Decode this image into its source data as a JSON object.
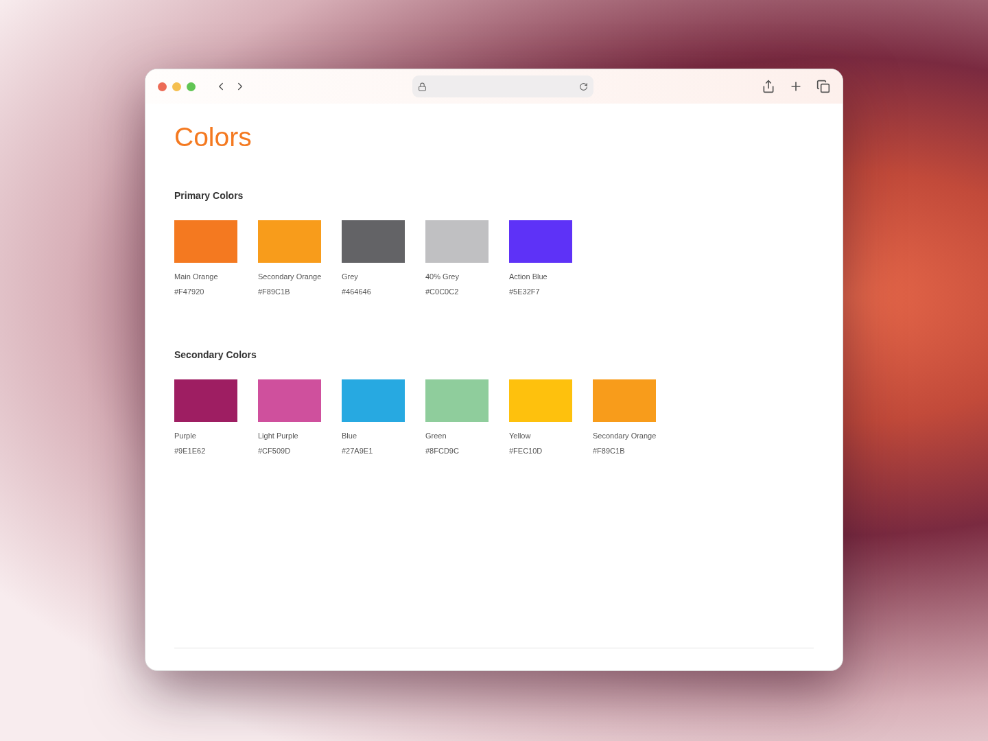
{
  "page": {
    "title": "Colors"
  },
  "sections": [
    {
      "heading": "Primary Colors",
      "swatches": [
        {
          "name": "Main Orange",
          "hex": "#F47920",
          "color": "#f47920"
        },
        {
          "name": "Secondary Orange",
          "hex": "#F89C1B",
          "color": "#f89c1b"
        },
        {
          "name": "Grey",
          "hex": "#464646",
          "color": "#636366"
        },
        {
          "name": "40% Grey",
          "hex": "#C0C0C2",
          "color": "#c0c0c2"
        },
        {
          "name": "Action Blue",
          "hex": "#5E32F7",
          "color": "#5e32f7"
        }
      ]
    },
    {
      "heading": "Secondary Colors",
      "swatches": [
        {
          "name": "Purple",
          "hex": "#9E1E62",
          "color": "#9e1e62"
        },
        {
          "name": "Light Purple",
          "hex": "#CF509D",
          "color": "#cf509d"
        },
        {
          "name": "Blue",
          "hex": "#27A9E1",
          "color": "#27a9e1"
        },
        {
          "name": "Green",
          "hex": "#8FCD9C",
          "color": "#8fcd9c"
        },
        {
          "name": "Yellow",
          "hex": "#FEC10D",
          "color": "#fec10d"
        },
        {
          "name": "Secondary Orange",
          "hex": "#F89C1B",
          "color": "#f89c1b"
        }
      ]
    }
  ]
}
